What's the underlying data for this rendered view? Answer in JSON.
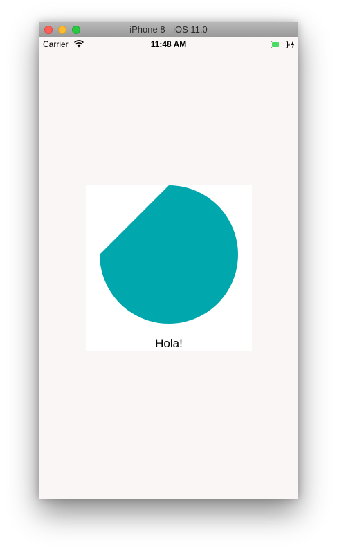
{
  "window": {
    "title": "iPhone 8 - iOS 11.0"
  },
  "status_bar": {
    "carrier": "Carrier",
    "time": "11:48 AM",
    "icons": [
      "wifi-icon",
      "battery-icon",
      "charging-icon"
    ]
  },
  "content": {
    "label": "Hola!",
    "shape_color": "#00a8ae",
    "background_color": "#faf6f5",
    "card_color": "#ffffff"
  }
}
